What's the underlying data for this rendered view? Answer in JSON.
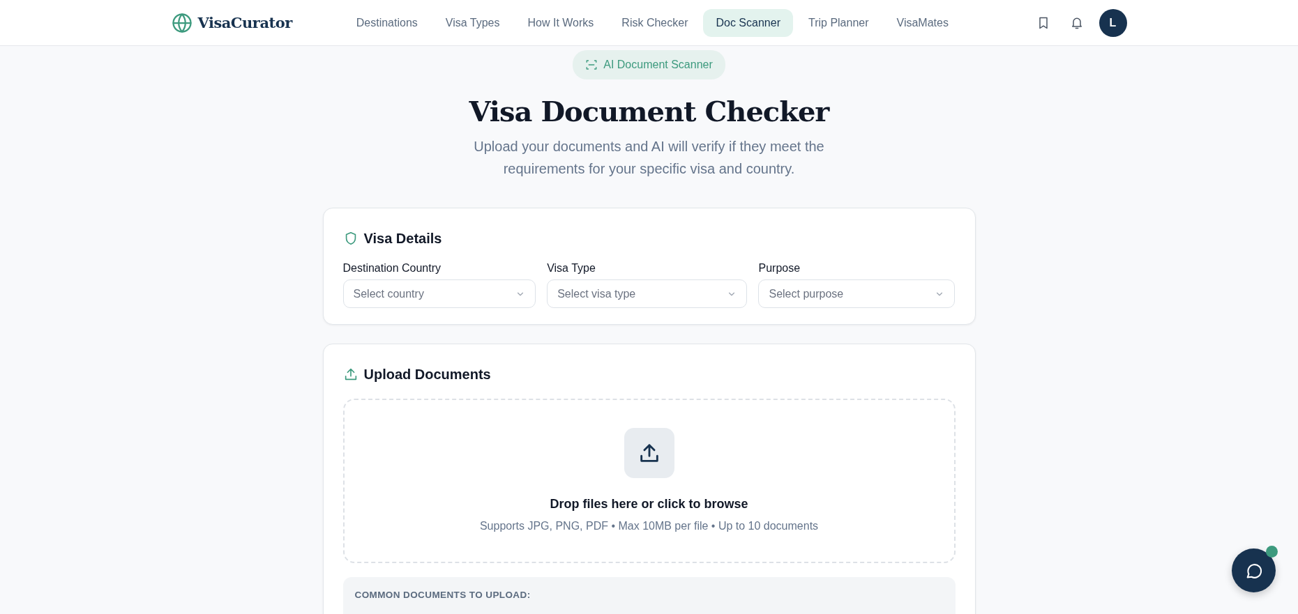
{
  "brand": {
    "name": "VisaCurator"
  },
  "nav": [
    {
      "label": "Destinations",
      "selected": false
    },
    {
      "label": "Visa Types",
      "selected": false
    },
    {
      "label": "How It Works",
      "selected": false
    },
    {
      "label": "Risk Checker",
      "selected": false
    },
    {
      "label": "Doc Scanner",
      "selected": true
    },
    {
      "label": "Trip Planner",
      "selected": false
    },
    {
      "label": "VisaMates",
      "selected": false
    }
  ],
  "user": {
    "initial": "L"
  },
  "badge": "AI Document Scanner",
  "title": "Visa Document Checker",
  "subtitle": "Upload your documents and AI will verify if they meet the requirements for your specific visa and country.",
  "visa_details": {
    "title": "Visa Details",
    "fields": [
      {
        "label": "Destination Country",
        "placeholder": "Select country"
      },
      {
        "label": "Visa Type",
        "placeholder": "Select visa type"
      },
      {
        "label": "Purpose",
        "placeholder": "Select purpose"
      }
    ]
  },
  "upload": {
    "title": "Upload Documents",
    "drop_title": "Drop files here or click to browse",
    "drop_hint": "Supports JPG, PNG, PDF • Max 10MB per file • Up to 10 documents",
    "common_title": "COMMON DOCUMENTS TO UPLOAD:"
  },
  "chat": {
    "online": true
  }
}
